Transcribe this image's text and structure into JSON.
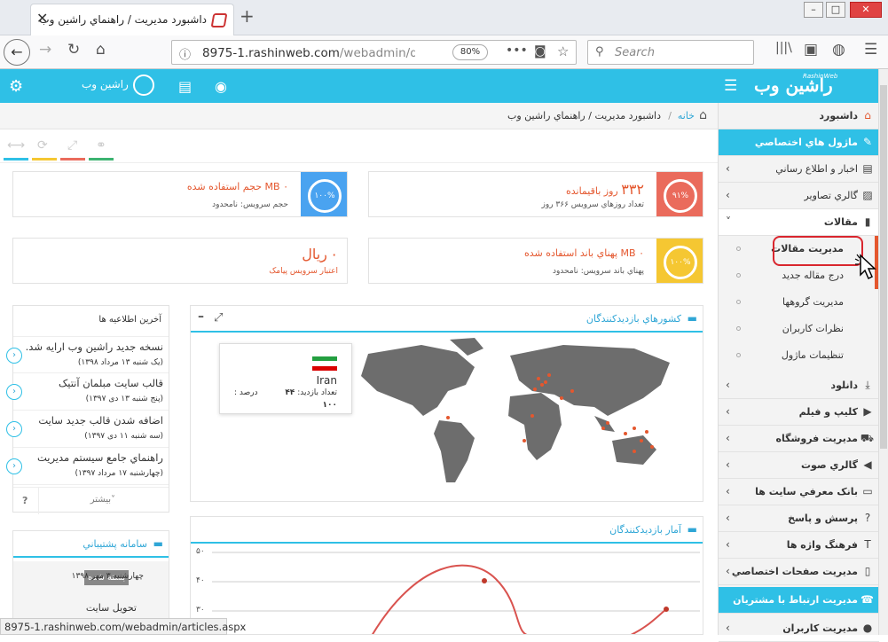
{
  "browser": {
    "tab_title": "داشبورد مدیریت / راهنماي راشين وب",
    "url_host": "8975-1.rashinweb.com",
    "url_path": "/webadmin/defa",
    "zoom": "80%",
    "search_placeholder": "Search",
    "status_url": "8975-1.rashinweb.com/webadmin/articles.aspx"
  },
  "topbar": {
    "logo": "راشين وب",
    "logo_small": "RashinWeb",
    "username": "راشين وب"
  },
  "breadcrumb": {
    "home": "خانه",
    "separator": "/",
    "current": "داشبورد مدیریت / راهنماي راشين وب"
  },
  "cards": {
    "disk": {
      "value": "۰ MB حجم استفاده شده",
      "sub": "حجم سرويس: نامحدود",
      "ring": "۱۰۰%"
    },
    "days": {
      "value_num": "۳۳۲",
      "value_text": "روز باقيمانده",
      "sub": "تعداد روزهاي سرويس ۳۶۶ روز",
      "ring": "۹۱%"
    },
    "sms": {
      "value_num": "۰",
      "value_text": "ريال",
      "sub": "اعتبار سرويس پيامک"
    },
    "bandwidth": {
      "value": "۰ MB پهناي باند استفاده شده",
      "sub": "پهناي باند سرويس: نامحدود",
      "ring": "۱۰۰%"
    }
  },
  "news": {
    "header": "آخرين اطلاعيه ها",
    "items": [
      {
        "title": "نسخه جديد راشين وب ارايه شد.",
        "date": "(يک شنبه ۱۳ مرداد ۱۳۹۸)"
      },
      {
        "title": "قالب سايت مبلمان آنتيک",
        "date": "(پنج شنبه ۱۳ دی ۱۳۹۷)"
      },
      {
        "title": "اضافه شدن قالب جديد سايت",
        "date": "(سه شنبه ۱۱ دی ۱۳۹۷)"
      },
      {
        "title": "راهنماي جامع سيستم مديريت",
        "date": "(چهارشنبه ۱۷ مرداد ۱۳۹۷)"
      }
    ],
    "more": "بيشتر",
    "help": "?"
  },
  "support": {
    "title": "سامانه پشتيباني",
    "badge": "بسته شده",
    "date": "چهارشنبه ۳ مهر ۱۳۹۸",
    "subject": "تحويل سايت"
  },
  "map_panel": {
    "title": "کشورهاي بازديدکنندگان",
    "country": "Iran",
    "visits_label": "تعداد بازديد:",
    "visits": "۴۴",
    "percent_label": "درصد :",
    "percent": "۱۰۰"
  },
  "stats_panel": {
    "title": "آمار بازديدکنندگان",
    "y_ticks": [
      "۵۰",
      "۴۰",
      "۳۰"
    ]
  },
  "sidebar": {
    "items": [
      {
        "label": "داشبورد",
        "icon": "home-icon"
      },
      {
        "label": "ماژول هاي اختصاصي",
        "icon": "pencil-icon"
      },
      {
        "label": "اخبار و اطلاع رساني",
        "icon": "news-icon"
      },
      {
        "label": "گالري تصاوير",
        "icon": "image-icon"
      },
      {
        "label": "مقالات",
        "icon": "file-icon"
      }
    ],
    "subitems": [
      "مديريت مقالات",
      "درج مقاله جديد",
      "مديريت گروهها",
      "نظرات کاربران",
      "تنظيمات ماژول"
    ],
    "items2": [
      {
        "label": "دانلود",
        "icon": "download-icon"
      },
      {
        "label": "کليپ و فيلم",
        "icon": "video-icon"
      },
      {
        "label": "مديريت فروشگاه",
        "icon": "cart-icon"
      },
      {
        "label": "گالري صوت",
        "icon": "audio-icon"
      },
      {
        "label": "بانک معرفي سايت ها",
        "icon": "monitor-icon"
      },
      {
        "label": "پرسش و پاسخ",
        "icon": "question-icon"
      },
      {
        "label": "فرهنگ واژه ها",
        "icon": "text-icon"
      },
      {
        "label": "مديريت صفحات اختصاصي",
        "icon": "page-icon"
      },
      {
        "label": "مديريت ارتباط با مشتريان",
        "icon": "crm-icon"
      },
      {
        "label": "مديريت کاربران",
        "icon": "user-icon"
      }
    ]
  },
  "colors": {
    "accent": "#2fc0e6",
    "card_blue": "#4aa3f0",
    "card_red": "#ea6b5c",
    "card_yellow": "#f5c732",
    "map_land": "#6d6d6d",
    "map_dot": "#e4572e",
    "highlight": "#d9262e"
  }
}
